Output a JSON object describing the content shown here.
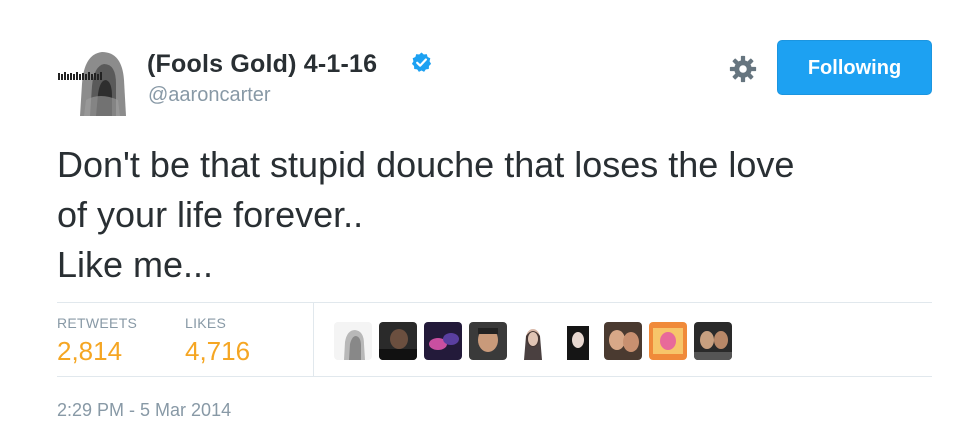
{
  "user": {
    "display_name": "(Fools Gold) 4-1-16",
    "handle": "@aaroncarter",
    "verified": true,
    "avatar_icon": "hooded-figure-avatar"
  },
  "actions": {
    "follow_label": "Following",
    "settings_icon": "gear-icon"
  },
  "tweet": {
    "lines": [
      "Don't be that stupid douche that loses the love",
      "of your life forever..",
      "Like me..."
    ]
  },
  "stats": {
    "retweets_label": "RETWEETS",
    "retweets_value": "2,814",
    "likes_label": "LIKES",
    "likes_value": "4,716"
  },
  "timestamp": "2:29 PM - 5 Mar 2014",
  "colors": {
    "accent": "#1da1f2",
    "stat_value": "#f5a623",
    "muted": "#8899a6",
    "text": "#292f33",
    "divider": "#e1e8ed"
  }
}
